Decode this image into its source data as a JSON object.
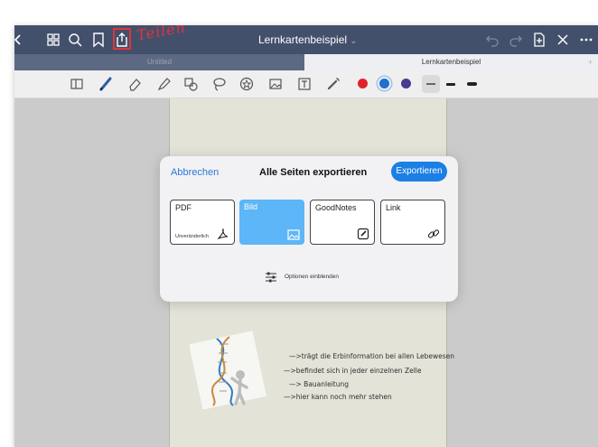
{
  "titlebar": {
    "document_title": "Lernkartenbeispiel",
    "title_chevron": "⌄",
    "annotation": "Teilen",
    "left_icons": [
      "close-icon",
      "grid-icon",
      "search-icon",
      "bookmark-icon",
      "share-icon"
    ],
    "right_icons": [
      "undo-icon",
      "redo-icon",
      "add-page-icon",
      "close-icon",
      "more-icon"
    ]
  },
  "tabs": {
    "items": [
      {
        "label": "Untitled"
      },
      {
        "label": "Lernkartenbeispiel"
      }
    ],
    "close_symbol": "×",
    "new_tab_symbol": "+"
  },
  "toolbar": {
    "tools": [
      "panel-icon",
      "pen-icon",
      "eraser-icon",
      "highlighter-icon",
      "shape-icon",
      "lasso-icon",
      "sticker-icon",
      "image-icon",
      "text-icon",
      "laser-icon"
    ],
    "colors": [
      "#e4212b",
      "#1f6fd1",
      "#4b3a8e"
    ],
    "strokes": [
      "thin",
      "medium",
      "thick"
    ]
  },
  "dialog": {
    "cancel_label": "Abbrechen",
    "title": "Alle Seiten exportieren",
    "export_label": "Exportieren",
    "options": [
      {
        "label": "PDF",
        "sublabel": "Unveränderlich",
        "icon": "acrobat-icon",
        "selected": false
      },
      {
        "label": "Bild",
        "sublabel": "",
        "icon": "image-icon",
        "selected": true
      },
      {
        "label": "GoodNotes",
        "sublabel": "",
        "icon": "goodnotes-icon",
        "selected": false
      },
      {
        "label": "Link",
        "sublabel": "",
        "icon": "link-icon",
        "selected": false
      }
    ],
    "show_options_label": "Optionen einblenden",
    "accent_color": "#1b7fe3"
  },
  "page": {
    "notes": [
      "—>trägt die Erbinformation bei allen Lebewesen",
      "—>befindet sich in jeder einzelnen Zelle",
      "—> Bauanleitung",
      "—>hier kann noch mehr stehen"
    ]
  }
}
